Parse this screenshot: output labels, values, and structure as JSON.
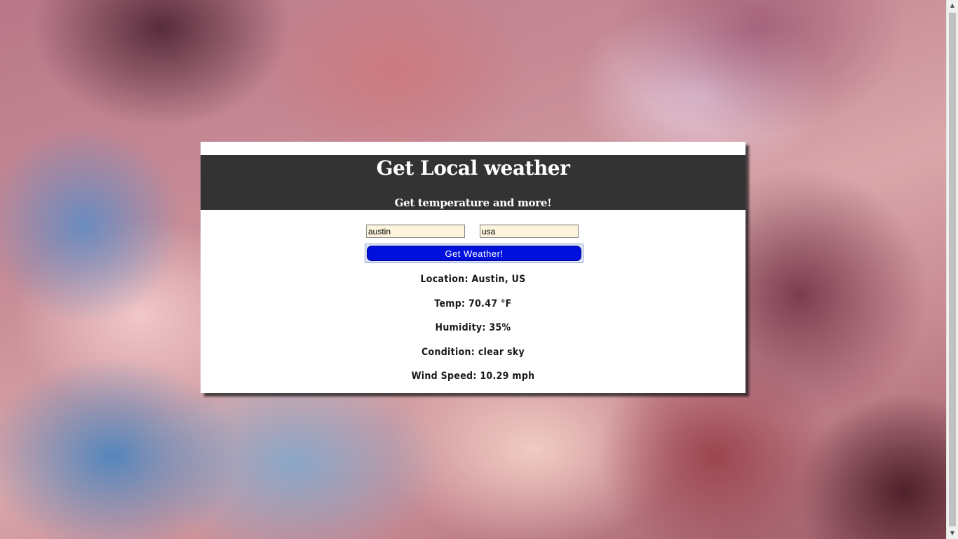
{
  "header": {
    "title": "Get Local weather",
    "subtitle": "Get temperature and more!"
  },
  "form": {
    "city_value": "austin",
    "country_value": "usa",
    "submit_label": "Get Weather!"
  },
  "results": {
    "location": "Location: Austin, US",
    "temp": "Temp: 70.47 °F",
    "humidity": "Humidity: 35%",
    "condition": "Condition: clear sky",
    "wind_speed": "Wind Speed: 10.29 mph"
  },
  "colors": {
    "header_bg": "#333333",
    "button_bg": "#0011dd",
    "input_bg": "#fbf3dc"
  },
  "icons": {
    "scroll_up": "scroll-up-arrow-icon",
    "scroll_down": "scroll-down-arrow-icon"
  }
}
